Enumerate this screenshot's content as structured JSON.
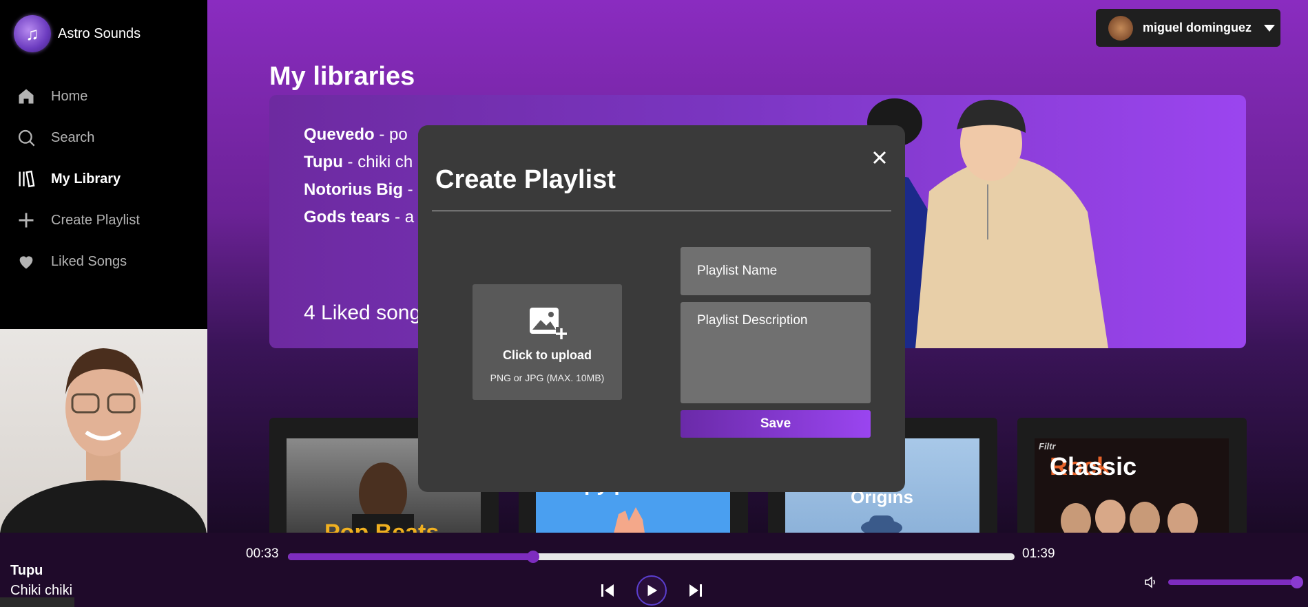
{
  "brand": {
    "name": "Astro Sounds"
  },
  "nav": [
    {
      "label": "Home",
      "icon": "home-icon"
    },
    {
      "label": "Search",
      "icon": "search-icon"
    },
    {
      "label": "My Library",
      "icon": "library-icon",
      "active": true
    },
    {
      "label": "Create Playlist",
      "icon": "plus-icon"
    },
    {
      "label": "Liked Songs",
      "icon": "heart-icon"
    }
  ],
  "user": {
    "name": "miguel dominguez"
  },
  "page": {
    "title": "My libraries"
  },
  "hero": {
    "songs": [
      {
        "artist": "Quevedo",
        "sep": " -  ",
        "song": "po"
      },
      {
        "artist": "Tupu",
        "sep": " -  ",
        "song": "chiki ch"
      },
      {
        "artist": "Notorius Big",
        "sep": " -",
        "song": ""
      },
      {
        "artist": "Gods tears",
        "sep": " -  ",
        "song": "a"
      }
    ],
    "liked": "4 Liked song"
  },
  "cards": [
    {
      "text": "Pop Beats"
    },
    {
      "text": "py p"
    },
    {
      "text": "Origins"
    },
    {
      "text_a": "Classic ",
      "text_b": "Rock",
      "tag": "Filtr"
    }
  ],
  "modal": {
    "title": "Create Playlist",
    "upload_label": "Click to upload",
    "upload_hint": "PNG or JPG (MAX. 10MB)",
    "name_placeholder": "Playlist Name",
    "desc_placeholder": "Playlist Description",
    "save_label": "Save"
  },
  "player": {
    "title": "Tupu",
    "artist": "Chiki chiki",
    "elapsed": "00:33",
    "duration": "01:39",
    "progress": 0.337,
    "volume": 1.0
  },
  "colors": {
    "accent": "#7d2cbf",
    "modal_bg": "#3a3a3a"
  }
}
